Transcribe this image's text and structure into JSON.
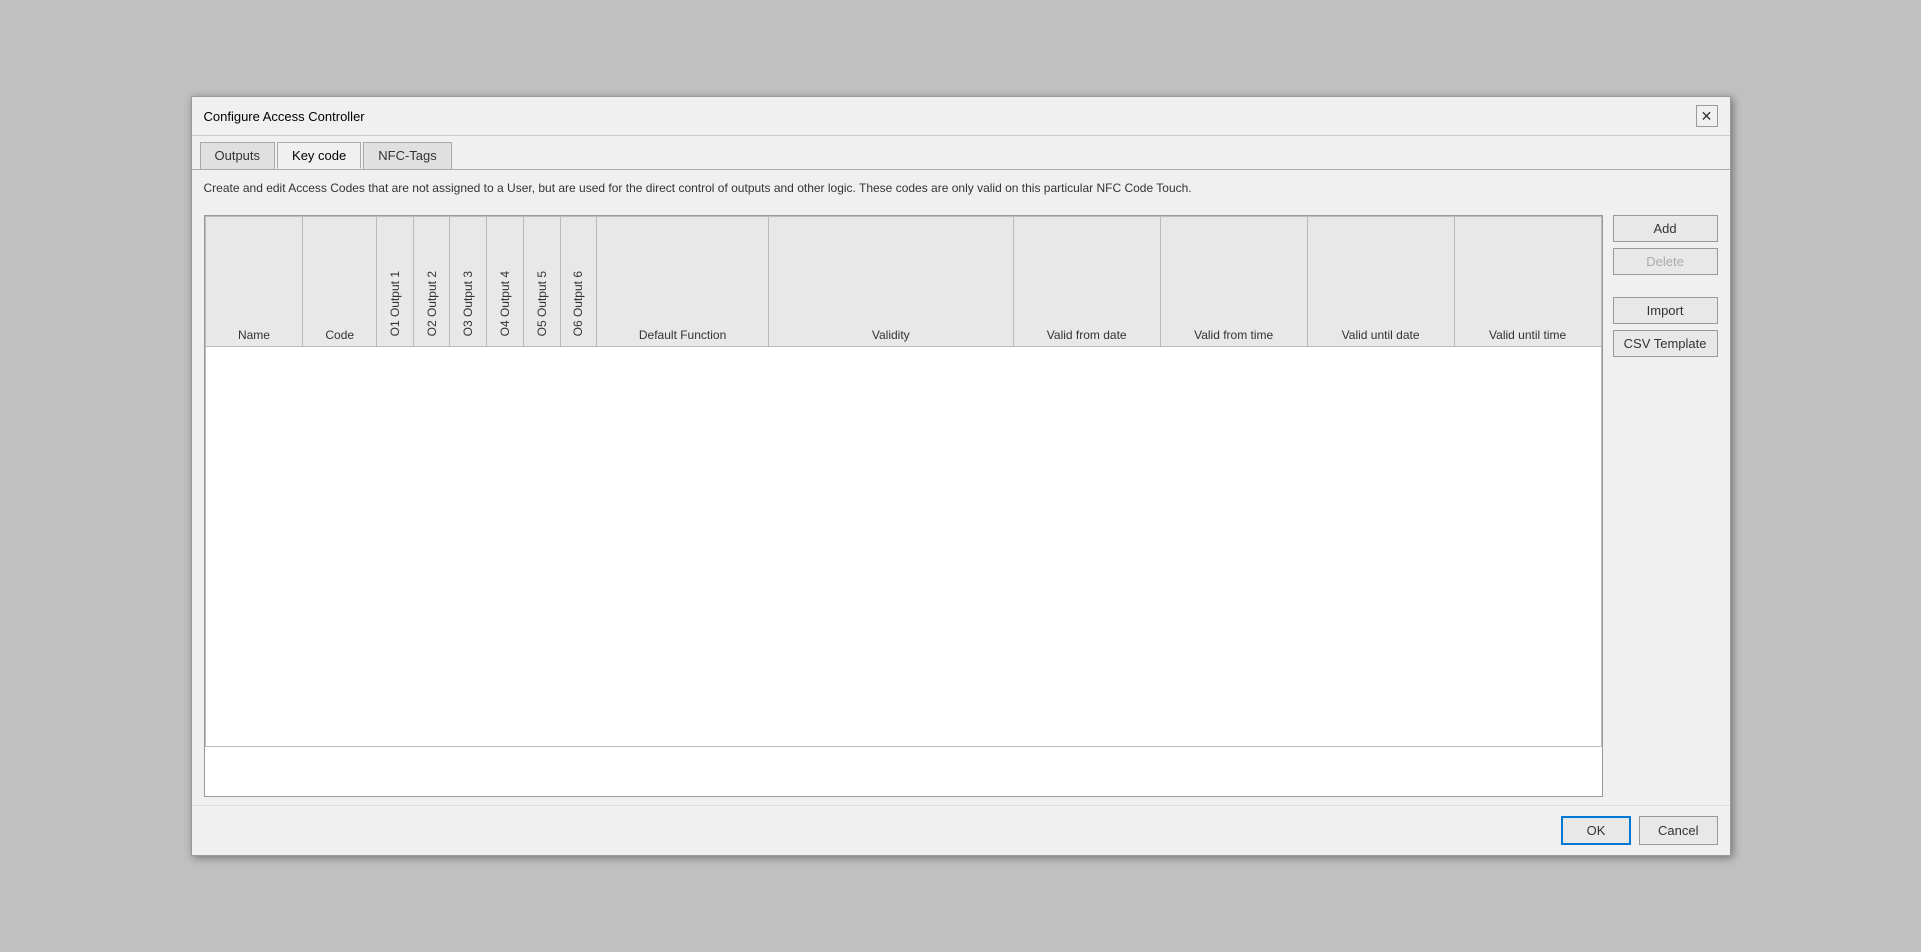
{
  "dialog": {
    "title": "Configure Access Controller",
    "close_label": "✕"
  },
  "tabs": [
    {
      "id": "outputs",
      "label": "Outputs",
      "active": false
    },
    {
      "id": "keycode",
      "label": "Key code",
      "active": true
    },
    {
      "id": "nfc-tags",
      "label": "NFC-Tags",
      "active": false
    }
  ],
  "description": "Create and edit Access Codes that are not assigned to a User, but are used for the direct control of outputs and other logic. These codes are only valid on this particular NFC Code Touch.",
  "table": {
    "columns": [
      {
        "id": "name",
        "label": "Name",
        "rotated": false,
        "class": "col-name"
      },
      {
        "id": "code",
        "label": "Code",
        "rotated": false,
        "class": "col-code"
      },
      {
        "id": "o1",
        "label": "O1 Output 1",
        "rotated": true,
        "class": "col-output"
      },
      {
        "id": "o2",
        "label": "O2 Output 2",
        "rotated": true,
        "class": "col-output"
      },
      {
        "id": "o3",
        "label": "O3 Output 3",
        "rotated": true,
        "class": "col-output"
      },
      {
        "id": "o4",
        "label": "O4 Output 4",
        "rotated": true,
        "class": "col-output"
      },
      {
        "id": "o5",
        "label": "O5 Output 5",
        "rotated": true,
        "class": "col-output"
      },
      {
        "id": "o6",
        "label": "O6 Output 6",
        "rotated": true,
        "class": "col-output"
      },
      {
        "id": "default-function",
        "label": "Default Function",
        "rotated": false,
        "class": "col-default-function"
      },
      {
        "id": "validity",
        "label": "Validity",
        "rotated": false,
        "class": "col-validity"
      },
      {
        "id": "valid-from-date",
        "label": "Valid from date",
        "rotated": false,
        "class": "col-date-time"
      },
      {
        "id": "valid-from-time",
        "label": "Valid from time",
        "rotated": false,
        "class": "col-date-time"
      },
      {
        "id": "valid-until-date",
        "label": "Valid until date",
        "rotated": false,
        "class": "col-date-time"
      },
      {
        "id": "valid-until-time",
        "label": "Valid until time",
        "rotated": false,
        "class": "col-date-time"
      }
    ],
    "rows": []
  },
  "buttons": {
    "add": "Add",
    "delete": "Delete",
    "import": "Import",
    "csv_template": "CSV Template"
  },
  "footer": {
    "ok": "OK",
    "cancel": "Cancel"
  }
}
